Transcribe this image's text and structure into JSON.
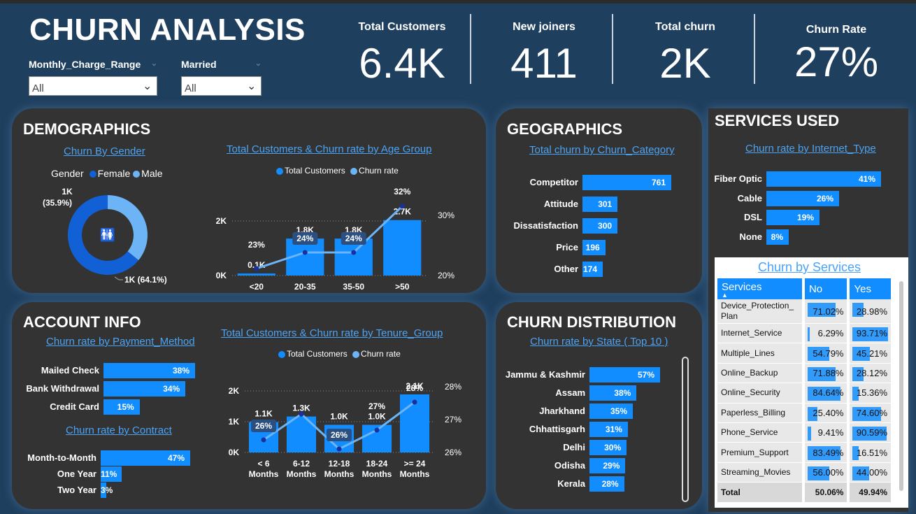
{
  "header": {
    "title": "CHURN ANALYSIS"
  },
  "slicers": [
    {
      "label": "Monthly_Charge_Range",
      "value": "All"
    },
    {
      "label": "Married",
      "value": "All"
    }
  ],
  "kpis": [
    {
      "label": "Total Customers",
      "value": "6.4K"
    },
    {
      "label": "New joiners",
      "value": "411"
    },
    {
      "label": "Total churn",
      "value": "2K"
    },
    {
      "label": "Churn Rate",
      "value": "27%"
    }
  ],
  "sections": {
    "demographics": "DEMOGRAPHICS",
    "geographics": "GEOGRAPHICS",
    "services": "SERVICES USED",
    "account": "ACCOUNT INFO",
    "distribution": "CHURN DISTRIBUTION"
  },
  "chart_data": [
    {
      "id": "gender",
      "type": "pie",
      "title": "Churn By Gender",
      "legend_title": "Gender",
      "categories": [
        "Female",
        "Male"
      ],
      "values": [
        64.1,
        35.9
      ],
      "labels": [
        "1K (64.1%)",
        "1K\n(35.9%)"
      ],
      "colors": [
        "#1260d6",
        "#6cb4f5"
      ]
    },
    {
      "id": "age",
      "type": "bar",
      "title": "Total Customers & Churn rate by Age Group",
      "categories": [
        "<20",
        "20-35",
        "35-50",
        ">50"
      ],
      "series": [
        {
          "name": "Total Customers",
          "values": [
            0.1,
            1.8,
            1.8,
            2.7
          ],
          "labels": [
            "0.1K",
            "1.8K",
            "1.8K",
            "2.7K"
          ]
        },
        {
          "name": "Churn rate",
          "values": [
            23,
            24,
            24,
            32
          ],
          "labels": [
            "23%",
            "24%",
            "24%",
            "32%"
          ]
        }
      ],
      "y_ticks": [
        "0K",
        "2K"
      ],
      "y2_ticks": [
        "20%",
        "30%"
      ],
      "ylim": [
        0,
        3.2
      ],
      "y2lim": [
        20,
        33
      ]
    },
    {
      "id": "churn_category",
      "type": "bar",
      "title": "Total churn by Churn_Category",
      "categories": [
        "Competitor",
        "Attitude",
        "Dissatisfaction",
        "Price",
        "Other"
      ],
      "values": [
        761,
        301,
        300,
        196,
        174
      ]
    },
    {
      "id": "internet_type",
      "type": "bar",
      "title": "Churn rate by Internet_Type",
      "categories": [
        "Fiber Optic",
        "Cable",
        "DSL",
        "None"
      ],
      "values": [
        41,
        26,
        19,
        8
      ],
      "labels": [
        "41%",
        "26%",
        "19%",
        "8%"
      ]
    },
    {
      "id": "payment",
      "type": "bar",
      "title": "Churn rate by Payment_Method",
      "categories": [
        "Mailed Check",
        "Bank Withdrawal",
        "Credit Card"
      ],
      "values": [
        38,
        34,
        15
      ],
      "labels": [
        "38%",
        "34%",
        "15%"
      ]
    },
    {
      "id": "contract",
      "type": "bar",
      "title": "Churn rate by Contract",
      "categories": [
        "Month-to-Month",
        "One Year",
        "Two Year"
      ],
      "values": [
        47,
        11,
        3
      ],
      "labels": [
        "47%",
        "11%",
        "3%"
      ]
    },
    {
      "id": "tenure",
      "type": "bar",
      "title": "Total Customers & Churn rate by Tenure_Group",
      "categories": [
        "< 6\nMonths",
        "6-12\nMonths",
        "12-18\nMonths",
        "18-24\nMonths",
        ">= 24\nMonths"
      ],
      "series": [
        {
          "name": "Total Customers",
          "values": [
            1.1,
            1.3,
            1.0,
            1.0,
            2.1
          ],
          "labels": [
            "1.1K",
            "1.3K",
            "1.0K",
            "1.0K",
            "2.1K"
          ]
        },
        {
          "name": "Churn rate",
          "values": [
            26,
            28,
            26,
            27,
            28
          ],
          "labels": [
            "26%",
            "",
            "26%",
            "27%",
            "28%"
          ]
        }
      ],
      "y_ticks": [
        "0K",
        "1K",
        "2K"
      ],
      "y2_ticks": [
        "26%",
        "27%",
        "28%"
      ],
      "ylim": [
        0,
        2.2
      ],
      "y2lim": [
        26,
        28
      ]
    },
    {
      "id": "state",
      "type": "bar",
      "title": "Churn rate by State ( Top 10 )",
      "categories": [
        "Jammu & Kashmir",
        "Assam",
        "Jharkhand",
        "Chhattisgarh",
        "Delhi",
        "Odisha",
        "Kerala"
      ],
      "values": [
        57,
        38,
        35,
        31,
        30,
        29,
        28
      ],
      "labels": [
        "57%",
        "38%",
        "35%",
        "31%",
        "30%",
        "29%",
        "28%"
      ]
    },
    {
      "id": "services",
      "type": "table",
      "title": "Churn by Services",
      "columns": [
        "Services",
        "No",
        "Yes"
      ],
      "rows": [
        {
          "name": "Device_Protection_\nPlan",
          "no": 71.02,
          "yes": 28.98,
          "no_l": "71.02%",
          "yes_l": "28.98%"
        },
        {
          "name": "Internet_Service",
          "no": 6.29,
          "yes": 93.71,
          "no_l": "6.29%",
          "yes_l": "93.71%"
        },
        {
          "name": "Multiple_Lines",
          "no": 54.79,
          "yes": 45.21,
          "no_l": "54.79%",
          "yes_l": "45.21%"
        },
        {
          "name": "Online_Backup",
          "no": 71.88,
          "yes": 28.12,
          "no_l": "71.88%",
          "yes_l": "28.12%"
        },
        {
          "name": "Online_Security",
          "no": 84.64,
          "yes": 15.36,
          "no_l": "84.64%",
          "yes_l": "15.36%"
        },
        {
          "name": "Paperless_Billing",
          "no": 25.4,
          "yes": 74.6,
          "no_l": "25.40%",
          "yes_l": "74.60%"
        },
        {
          "name": "Phone_Service",
          "no": 9.41,
          "yes": 90.59,
          "no_l": "9.41%",
          "yes_l": "90.59%"
        },
        {
          "name": "Premium_Support",
          "no": 83.49,
          "yes": 16.51,
          "no_l": "83.49%",
          "yes_l": "16.51%"
        },
        {
          "name": "Streaming_Movies",
          "no": 56.0,
          "yes": 44.0,
          "no_l": "56.00%",
          "yes_l": "44.00%"
        }
      ],
      "total": {
        "name": "Total",
        "no_l": "50.06%",
        "yes_l": "49.94%"
      }
    }
  ],
  "colors": {
    "bar": "#118dff",
    "line": "#6cb4f5",
    "panel": "#333333",
    "background": "#1f3f5e"
  }
}
